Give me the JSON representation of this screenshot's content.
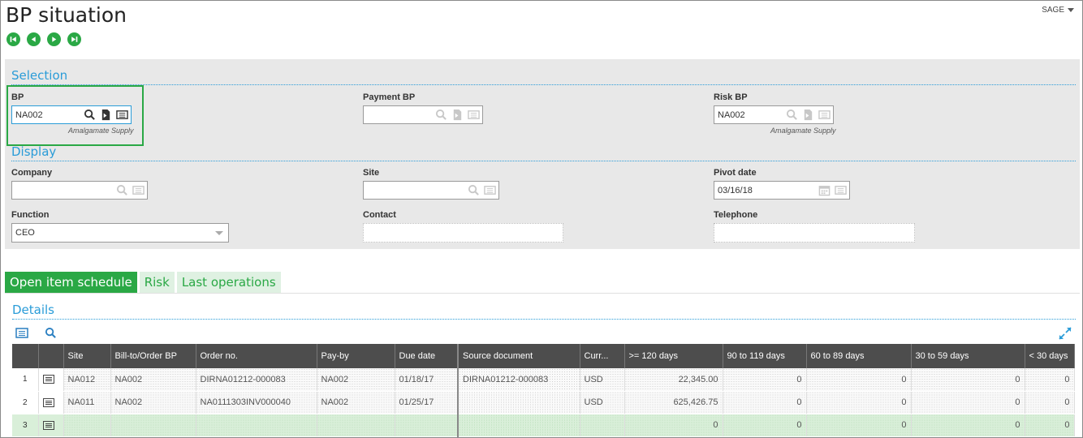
{
  "page": {
    "title": "BP situation",
    "user_menu": "SAGE"
  },
  "nav": {
    "first": "first-record",
    "previous": "previous-record",
    "next": "next-record",
    "last": "last-record"
  },
  "selection": {
    "title": "Selection",
    "bp": {
      "label": "BP",
      "value": "NA002",
      "description": "Amalgamate Supply"
    },
    "payment_bp": {
      "label": "Payment BP",
      "value": ""
    },
    "risk_bp": {
      "label": "Risk BP",
      "value": "NA002",
      "description": "Amalgamate Supply"
    }
  },
  "display": {
    "title": "Display",
    "company": {
      "label": "Company",
      "value": ""
    },
    "site": {
      "label": "Site",
      "value": ""
    },
    "pivot_date": {
      "label": "Pivot date",
      "value": "03/16/18"
    },
    "function": {
      "label": "Function",
      "value": "CEO"
    },
    "contact": {
      "label": "Contact",
      "value": ""
    },
    "telephone": {
      "label": "Telephone",
      "value": ""
    }
  },
  "tabs": [
    {
      "label": "Open item schedule",
      "active": true
    },
    {
      "label": "Risk",
      "active": false
    },
    {
      "label": "Last operations",
      "active": false
    }
  ],
  "details": {
    "title": "Details",
    "columns": [
      "",
      "Site",
      "Bill-to/Order BP",
      "Order no.",
      "Pay-by",
      "Due date",
      "Source document",
      "Curr...",
      ">= 120 days",
      "90 to 119 days",
      "60 to 89 days",
      "30 to 59 days",
      "< 30 days"
    ],
    "rows": [
      {
        "num": "1",
        "site": "NA012",
        "bill_to": "NA002",
        "order_no": "DIRNA01212-000083",
        "pay_by": "NA002",
        "due_date": "01/18/17",
        "source_doc": "DIRNA01212-000083",
        "currency": "USD",
        "d120": "22,345.00",
        "d90": "0",
        "d60": "0",
        "d30": "0",
        "dlt30": "0"
      },
      {
        "num": "2",
        "site": "NA011",
        "bill_to": "NA002",
        "order_no": "NA0111303INV000040",
        "pay_by": "NA002",
        "due_date": "01/25/17",
        "source_doc": "",
        "currency": "USD",
        "d120": "625,426.75",
        "d90": "0",
        "d60": "0",
        "d30": "0",
        "dlt30": "0"
      },
      {
        "num": "3",
        "site": "",
        "bill_to": "",
        "order_no": "",
        "pay_by": "",
        "due_date": "",
        "source_doc": "",
        "currency": "",
        "d120": "0",
        "d90": "0",
        "d60": "0",
        "d30": "0",
        "dlt30": "0"
      }
    ]
  },
  "colors": {
    "accent_green": "#2aa845",
    "section_blue": "#2a9cd8",
    "header_dark": "#4d4d4d"
  }
}
